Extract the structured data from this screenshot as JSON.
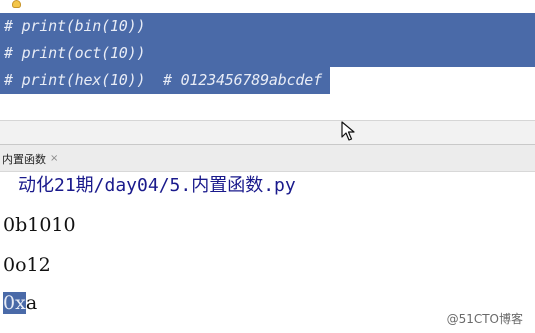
{
  "editor": {
    "lines": [
      "# print(bin(10))",
      "# print(oct(10))",
      "# print(hex(10))  # 0123456789abcdef"
    ]
  },
  "run_panel": {
    "tab_label": "内置函数",
    "tab_close": "×",
    "title": "动化21期/day04/5.内置函数.py",
    "output": [
      "0b1010",
      "0o12"
    ],
    "last_line": {
      "highlighted": "0x",
      "rest": "a"
    }
  },
  "watermark": "@51CTO博客",
  "colors": {
    "selection": "#4a6aa8",
    "selection_text": "#e8ecf6",
    "console_title": "#1a1a8c",
    "intention_bulb": "#f3c64a"
  },
  "icons": {
    "bulb": "intention-bulb-icon",
    "cursor": "mouse-pointer-icon",
    "close": "close-icon"
  }
}
